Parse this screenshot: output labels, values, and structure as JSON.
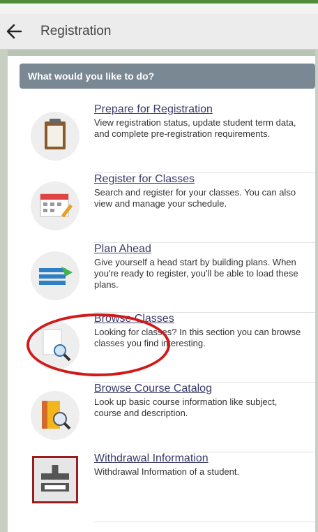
{
  "header": {
    "title": "Registration"
  },
  "section": {
    "title": "What would you like to do?"
  },
  "items": [
    {
      "title": "Prepare for Registration",
      "description": "View registration status, update student term data, and complete pre-registration requirements.",
      "icon": "clipboard-icon"
    },
    {
      "title": "Register for Classes",
      "description": "Search and register for your classes. You can also view and manage your schedule.",
      "icon": "calendar-icon"
    },
    {
      "title": "Plan Ahead",
      "description": "Give yourself a head start by building plans. When you're ready to register, you'll be able to load these plans.",
      "icon": "plan-icon"
    },
    {
      "title": "Browse Classes",
      "description": "Looking for classes? In this section you can browse classes you find interesting.",
      "icon": "magnifier-document-icon"
    },
    {
      "title": "Browse Course Catalog",
      "description": "Look up basic course information like subject, course and description.",
      "icon": "catalog-icon"
    },
    {
      "title": "Withdrawal Information",
      "description": "Withdrawal Information of a student.",
      "icon": "withdrawal-icon"
    }
  ],
  "colors": {
    "header_bar": "#7a8893",
    "accent": "#4f8b3a",
    "annotation": "#d11a1a",
    "link": "#3b3b6b"
  },
  "annotation": {
    "highlighted_item": "Browse Classes"
  }
}
